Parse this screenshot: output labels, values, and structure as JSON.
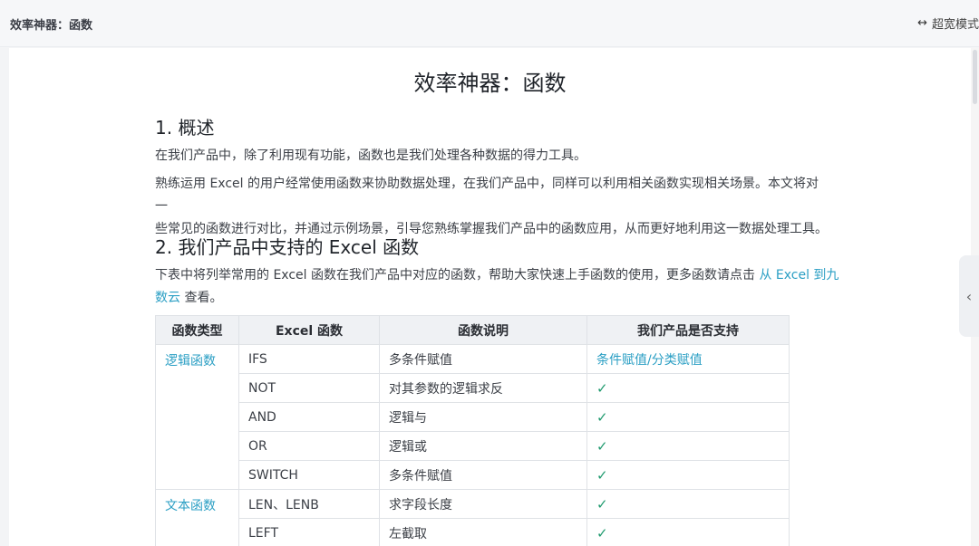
{
  "header": {
    "breadcrumb": "效率神器：函数",
    "wide_mode_label": "超宽模式",
    "wide_mode_icon": "↔"
  },
  "doc": {
    "title": "效率神器：函数",
    "section1": {
      "heading": "1. 概述",
      "p1": "在我们产品中，除了利用现有功能，函数也是我们处理各种数据的得力工具。",
      "p2_line1": "熟练运用 Excel 的用户经常使用函数来协助数据处理，在我们产品中，同样可以利用相关函数实现相关场景。本文将对一",
      "p2_line2": "些常见的函数进行对比，并通过示例场景，引导您熟练掌握我们产品中的函数应用，从而更好地利用这一数据处理工具。"
    },
    "section2": {
      "heading": "2. 我们产品中支持的 Excel 函数",
      "p_line1_prefix": "下表中将列举常用的 Excel 函数在我们产品中对应的函数，帮助大家快速上手函数的使用，更多函数请点击 ",
      "p_link_part1": "从 Excel 到九",
      "p_link_part2": "数云",
      "p_suffix": " 查看。"
    }
  },
  "table": {
    "headers": [
      "函数类型",
      "Excel 函数",
      "函数说明",
      "我们产品是否支持"
    ],
    "check_mark": "✓",
    "groups": [
      {
        "type": "逻辑函数",
        "rows": [
          {
            "fn": "IFS",
            "desc": "多条件赋值",
            "support": "条件赋值/分类赋值"
          },
          {
            "fn": "NOT",
            "desc": "对其参数的逻辑求反",
            "support": "✓"
          },
          {
            "fn": "AND",
            "desc": "逻辑与",
            "support": "✓"
          },
          {
            "fn": "OR",
            "desc": "逻辑或",
            "support": "✓"
          },
          {
            "fn": "SWITCH",
            "desc": "多条件赋值",
            "support": "✓"
          }
        ]
      },
      {
        "type": "文本函数",
        "rows": [
          {
            "fn": "LEN、LENB",
            "desc": "求字段长度",
            "support": "✓"
          },
          {
            "fn": "LEFT",
            "desc": "左截取",
            "support": "✓"
          }
        ]
      }
    ]
  },
  "ui": {
    "side_toggle_icon": "‹"
  }
}
